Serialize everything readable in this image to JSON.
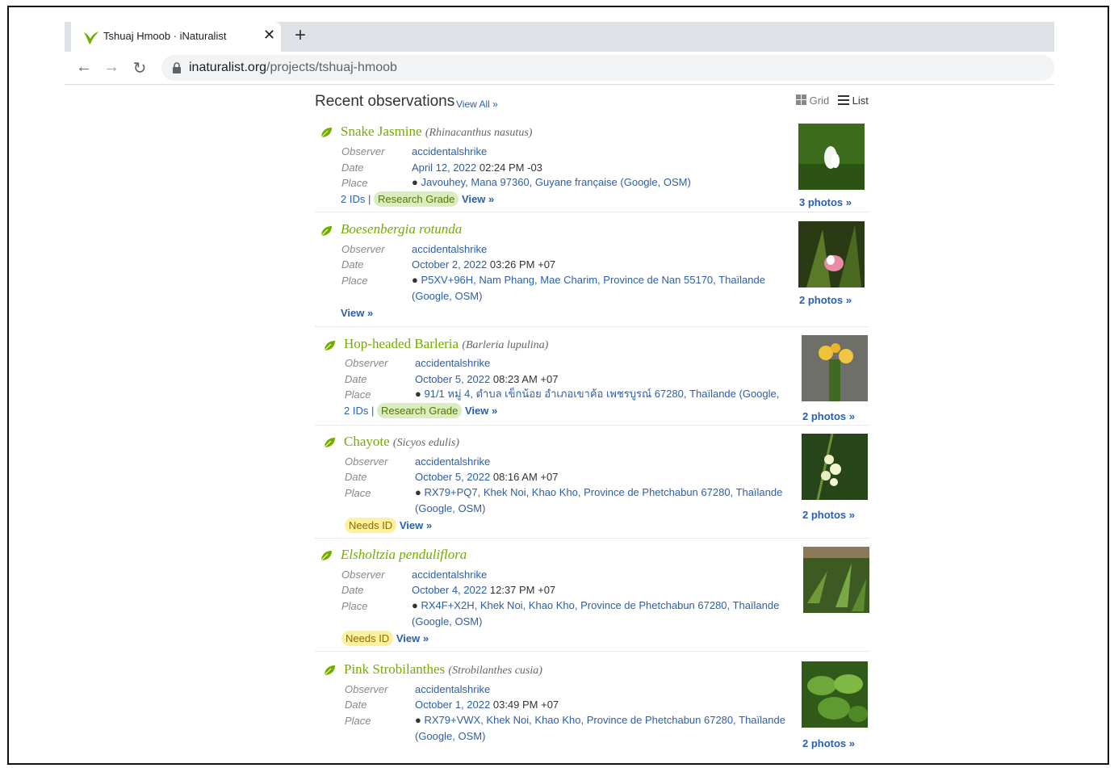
{
  "browser": {
    "tab_title": "Tshuaj Hmoob · iNaturalist",
    "url_host": "inaturalist.org",
    "url_path": "/projects/tshuaj-hmoob",
    "close_glyph": "✕",
    "new_tab_glyph": "+",
    "back_glyph": "←",
    "forward_glyph": "→",
    "reload_glyph": "↻"
  },
  "page": {
    "heading": "Recent observations",
    "view_all": "View All »",
    "grid_label": "Grid",
    "list_label": "List",
    "observer_label": "Observer",
    "date_label": "Date",
    "place_label": "Place"
  },
  "observations": [
    {
      "common": "Snake Jasmine",
      "scientific": "(Rhinacanthus nasutus)",
      "observer": "accidentalshrike",
      "date_link": "April 12, 2022",
      "time": "02:24 PM -03",
      "place": "Javouhey, Mana 97360, Guyane française (Google, OSM)",
      "ids": "2 IDs |",
      "grade": "Research Grade",
      "view": "View »",
      "photos": "3 photos »"
    },
    {
      "common": "Boesenbergia rotunda",
      "scientific": "",
      "observer": "accidentalshrike",
      "date_link": "October 2, 2022",
      "time": "03:26 PM +07",
      "place": "P5XV+96H, Nam Phang, Mae Charim, Province de Nan 55170, Thaïlande (Google, OSM)",
      "ids": "",
      "grade": "",
      "view": "View »",
      "photos": "2 photos »"
    },
    {
      "common": "Hop-headed Barleria",
      "scientific": "(Barleria lupulina)",
      "observer": "accidentalshrike",
      "date_link": "October 5, 2022",
      "time": "08:23 AM +07",
      "place": "91/1 หมู่ 4, ตำบล เข็กน้อย อำเภอเขาค้อ เพชรบูรณ์ 67280, Thaïlande (Google, OSM)",
      "ids": "2 IDs |",
      "grade": "Research Grade",
      "view": "View »",
      "photos": "2 photos »"
    },
    {
      "common": "Chayote",
      "scientific": "(Sicyos edulis)",
      "observer": "accidentalshrike",
      "date_link": "October 5, 2022",
      "time": "08:16 AM +07",
      "place": "RX79+PQ7, Khek Noi, Khao Kho, Province de Phetchabun 67280, Thaïlande (Google, OSM)",
      "ids": "",
      "grade": "Needs ID",
      "view": "View »",
      "photos": "2 photos »"
    },
    {
      "common": "Elsholtzia penduliflora",
      "scientific": "",
      "observer": "accidentalshrike",
      "date_link": "October 4, 2022",
      "time": "12:37 PM +07",
      "place": "RX4F+X2H, Khek Noi, Khao Kho, Province de Phetchabun 67280, Thaïlande (Google, OSM)",
      "ids": "",
      "grade": "Needs ID",
      "view": "View »",
      "photos": ""
    },
    {
      "common": "Pink Strobilanthes",
      "scientific": "(Strobilanthes cusia)",
      "observer": "accidentalshrike",
      "date_link": "October 1, 2022",
      "time": "03:49 PM +07",
      "place": "RX79+VWX, Khek Noi, Khao Kho, Province de Phetchabun 67280, Thaïlande (Google, OSM)",
      "ids": "",
      "grade": "",
      "view": "",
      "photos": "2 photos »"
    }
  ]
}
